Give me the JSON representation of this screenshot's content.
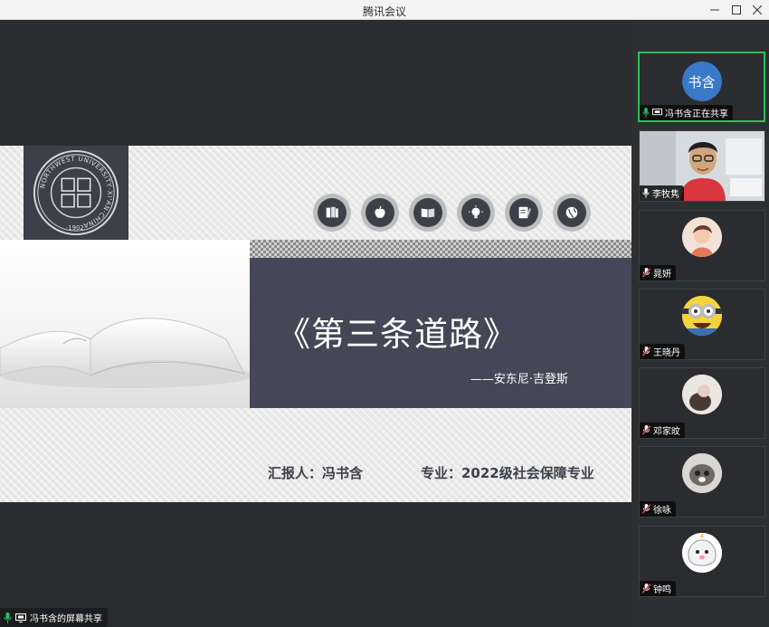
{
  "window": {
    "title": "腾讯会议"
  },
  "slide": {
    "title": "《第三条道路》",
    "subtitle": "——安东尼·吉登斯",
    "reporter": "汇报人：冯书含",
    "major": "专业：2022级社会保障专业",
    "icons": [
      "books-icon",
      "apple-icon",
      "open-book-icon",
      "lightbulb-icon",
      "notebook-icon",
      "globe-icon"
    ],
    "logo_ring_text": "NORTHWEST UNIVERSITY·XI'AN·CHINA",
    "logo_year": "·1902·"
  },
  "share_label": "冯书含的屏幕共享",
  "participants": [
    {
      "name": "冯书含正在共享",
      "avatar_text": "书含",
      "avatar_color": "#3a78c8",
      "active": true
    },
    {
      "name": "李牧隽",
      "avatar_text": "",
      "video": true
    },
    {
      "name": "晁妍",
      "avatar_text": ""
    },
    {
      "name": "王晓丹",
      "avatar_text": ""
    },
    {
      "name": "邓家旼",
      "avatar_text": ""
    },
    {
      "name": "徐咏",
      "avatar_text": ""
    },
    {
      "name": "钟鸣",
      "avatar_text": ""
    }
  ],
  "colors": {
    "accent": "#27c25f",
    "slide_dark": "#454757",
    "mic_muted": "#e0454d"
  }
}
